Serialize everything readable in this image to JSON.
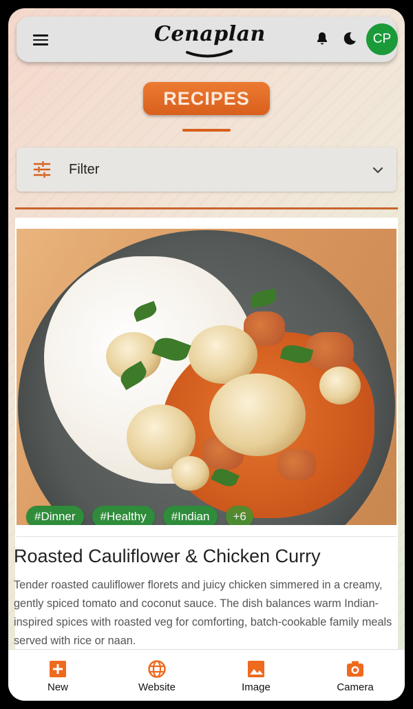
{
  "app": {
    "brand": "Cenaplan",
    "avatar_initials": "CP"
  },
  "page": {
    "title": "RECIPES"
  },
  "filter": {
    "label": "Filter"
  },
  "recipe": {
    "title": "Roasted Cauliflower & Chicken Curry",
    "description": "Tender roasted cauliflower florets and juicy chicken simmered in a creamy, gently spiced tomato and coconut sauce. The dish balances warm Indian-inspired spices with roasted veg for comforting, batch-cookable family meals served with rice or naan.",
    "tags": [
      "#Dinner",
      "#Healthy",
      "#Indian"
    ],
    "more_tags": "+6"
  },
  "bottom_nav": {
    "items": [
      {
        "label": "New",
        "icon": "plus-box-icon"
      },
      {
        "label": "Website",
        "icon": "globe-icon"
      },
      {
        "label": "Image",
        "icon": "image-icon"
      },
      {
        "label": "Camera",
        "icon": "camera-icon"
      }
    ]
  },
  "colors": {
    "accent": "#d8601c",
    "tag": "#2e8c3a",
    "avatar": "#1b9a3a"
  }
}
